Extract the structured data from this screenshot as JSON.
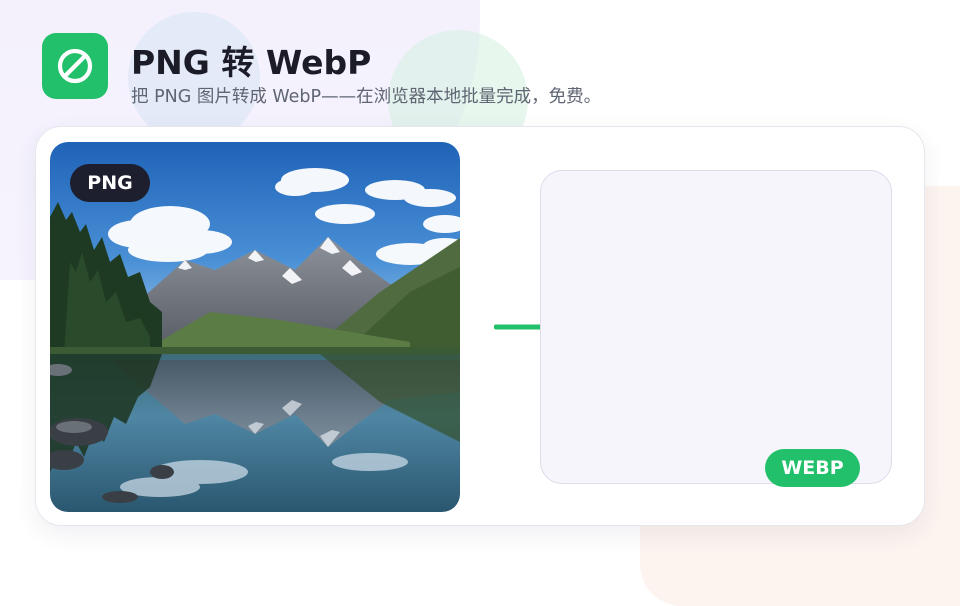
{
  "header": {
    "icon": "prohibition-icon",
    "title": "PNG 转 WebP",
    "subtitle": "把 PNG 图片转成 WebP——在浏览器本地批量完成，免费。"
  },
  "source": {
    "badge": "PNG",
    "image": "mountain-lake-photo"
  },
  "arrow": {
    "icon": "arrow-right-icon"
  },
  "output": {
    "badge": "WEBP"
  },
  "colors": {
    "accent_green": "#22c06b",
    "dark_badge": "#1e1f2e",
    "title_text": "#1c1c28",
    "subtitle_text": "#5f6573",
    "output_bg": "#f5f5fb"
  }
}
